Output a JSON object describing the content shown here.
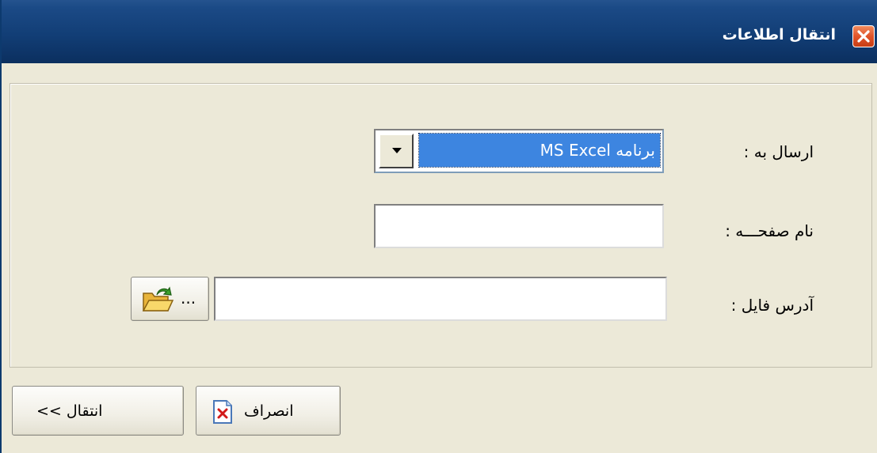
{
  "window": {
    "title": "انتقال اطلاعات",
    "close_icon": "close-icon"
  },
  "form": {
    "send_to_label": "ارسال به :",
    "send_to_value": "برنامه MS Excel",
    "page_name_label": "نام صفحـــه :",
    "page_name_value": "",
    "file_address_label": "آدرس فایل :",
    "file_address_value": "",
    "browse_label": "...",
    "browse_icon": "folder-open-icon"
  },
  "footer": {
    "cancel_label": "انصراف",
    "cancel_icon": "document-cancel-icon",
    "transfer_label": "انتقال >>"
  },
  "colors": {
    "title_bar": "#123e76",
    "close_button": "#e0542a",
    "selection": "#3d85e0",
    "face": "#ece9d8"
  }
}
